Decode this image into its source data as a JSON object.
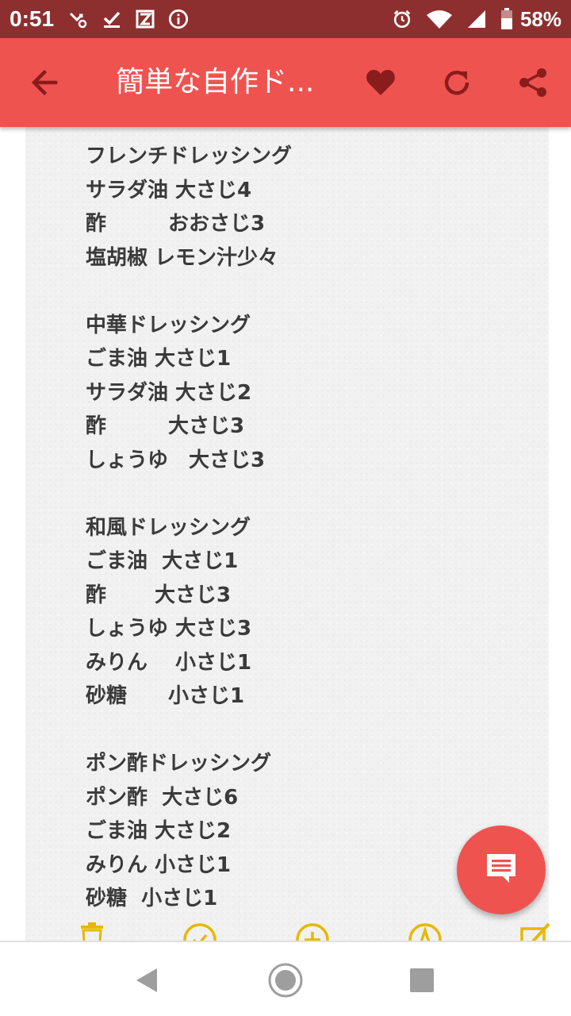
{
  "status_bar": {
    "time": "0:51",
    "battery": "58%",
    "icons": [
      "missed-call-icon",
      "checkmark-icon",
      "app-icon",
      "info-icon",
      "alarm-icon",
      "wifi-icon",
      "signal-icon",
      "battery-icon"
    ]
  },
  "app_bar": {
    "title": "簡単な自作ド...",
    "back_icon": "arrow-left-icon",
    "actions": [
      "heart-icon",
      "refresh-icon",
      "share-icon"
    ]
  },
  "recipe_lines": [
    "フレンチドレッシング",
    "サラダ油 大さじ4",
    "酢　　　おおさじ3",
    "塩胡椒 レモン汁少々",
    "",
    "中華ドレッシング",
    "ごま油 大さじ1",
    "サラダ油 大さじ2",
    "酢　　　大さじ3",
    "しょうゆ　大さじ3",
    "",
    "和風ドレッシング",
    "ごま油  大さじ1",
    "酢　　 大さじ3",
    "しょうゆ 大さじ3",
    "みりん　 小さじ1",
    "砂糖　　小さじ1",
    "",
    "ポン酢ドレッシング",
    "ポン酢  大さじ6",
    "ごま油 大さじ2",
    "みりん 小さじ1",
    "砂糖  小さじ1"
  ],
  "colors": {
    "status_bar": "#8e2f2f",
    "app_bar": "#ef5350",
    "fab": "#ef5350",
    "icon_dark": "#8b1c1c",
    "text": "#3a3a3a",
    "bottom_icon": "#e6b800"
  },
  "fab": {
    "icon": "chat-icon"
  },
  "nav_bar": [
    "back-triangle-icon",
    "home-circle-icon",
    "recents-square-icon"
  ]
}
